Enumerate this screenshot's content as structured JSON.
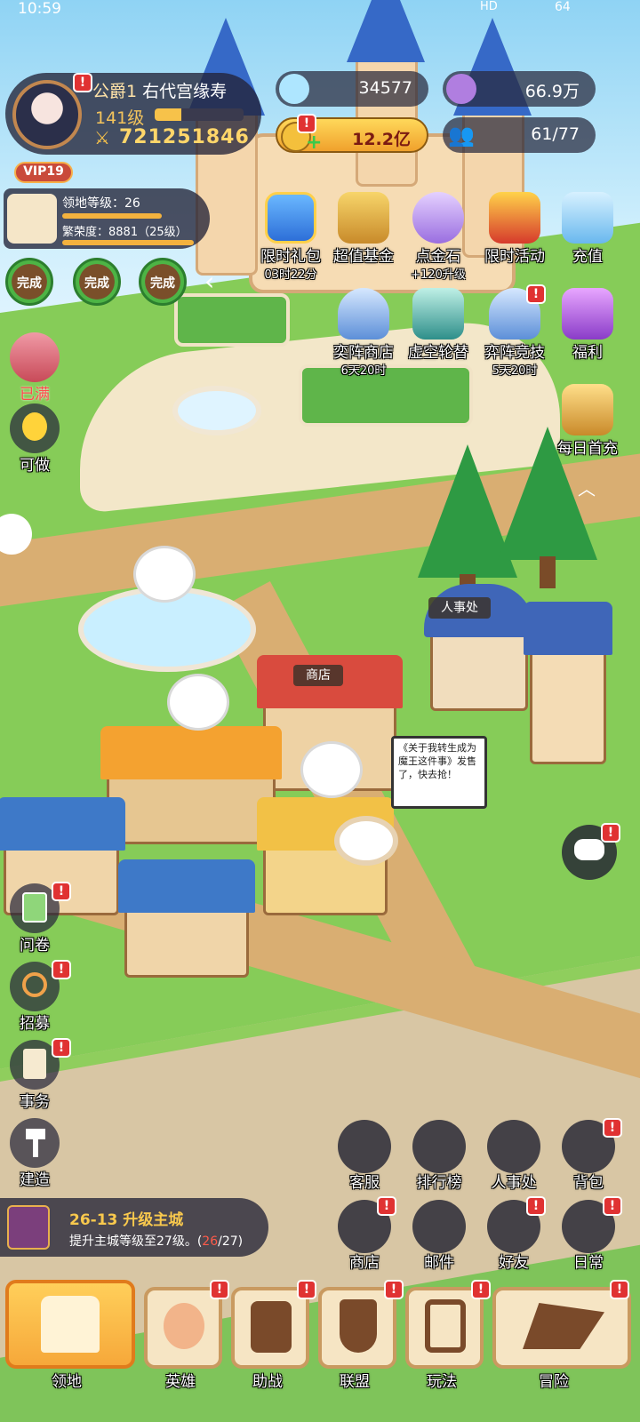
{
  "status_bar": {
    "time": "10:59",
    "network": "HD",
    "battery": "64"
  },
  "profile": {
    "title": "公爵1",
    "name": "右代宫缘寿",
    "level": "141级",
    "exp_progress": 0.3,
    "power": "721251846",
    "vip": "VIP19"
  },
  "territory": {
    "level_label": "领地等级：26",
    "prosperity_label": "繁荣度：8881（25级）"
  },
  "complete_buttons": [
    "完成",
    "完成",
    "完成"
  ],
  "currencies": {
    "crystal": "34577",
    "purple_coin": "66.9万",
    "gold": "12.2亿",
    "population": "61/77"
  },
  "events_row1": [
    {
      "name": "限时礼包",
      "sub": "03时22分"
    },
    {
      "name": "超值基金",
      "sub": ""
    },
    {
      "name": "点金石",
      "sub": "+120升级"
    },
    {
      "name": "限时活动",
      "sub": ""
    },
    {
      "name": "充值",
      "sub": ""
    }
  ],
  "events_row2": [
    {
      "name": "奕阵商店",
      "sub": "6天20时"
    },
    {
      "name": "虚空轮替",
      "sub": ""
    },
    {
      "name": "弈阵竞技",
      "sub": "5天20时"
    },
    {
      "name": "福利",
      "sub": ""
    }
  ],
  "daily_first": "每日首充",
  "left_top": [
    {
      "name": "已满"
    },
    {
      "name": "可做"
    }
  ],
  "left_bottom": [
    {
      "name": "问卷"
    },
    {
      "name": "招募"
    },
    {
      "name": "事务"
    },
    {
      "name": "建造"
    }
  ],
  "map_labels": {
    "personnel": "人事处",
    "shop": "商店",
    "speech": "《关于我转生成为魔王这件事》发售了，快去抢！"
  },
  "grid_row1": [
    "客服",
    "排行榜",
    "人事处",
    "背包"
  ],
  "grid_row2": [
    "商店",
    "邮件",
    "好友",
    "日常"
  ],
  "quest": {
    "title": "26-13 升级主城",
    "desc_prefix": "提升主城等级至27级。(",
    "current": "26",
    "desc_suffix": "/27)"
  },
  "nav": [
    "领地",
    "英雄",
    "助战",
    "联盟",
    "玩法",
    "冒险"
  ],
  "alert_mark": "!",
  "colors": {
    "accent": "#f6a83a",
    "alert": "#e03232",
    "gold_text": "#ffd66a"
  }
}
